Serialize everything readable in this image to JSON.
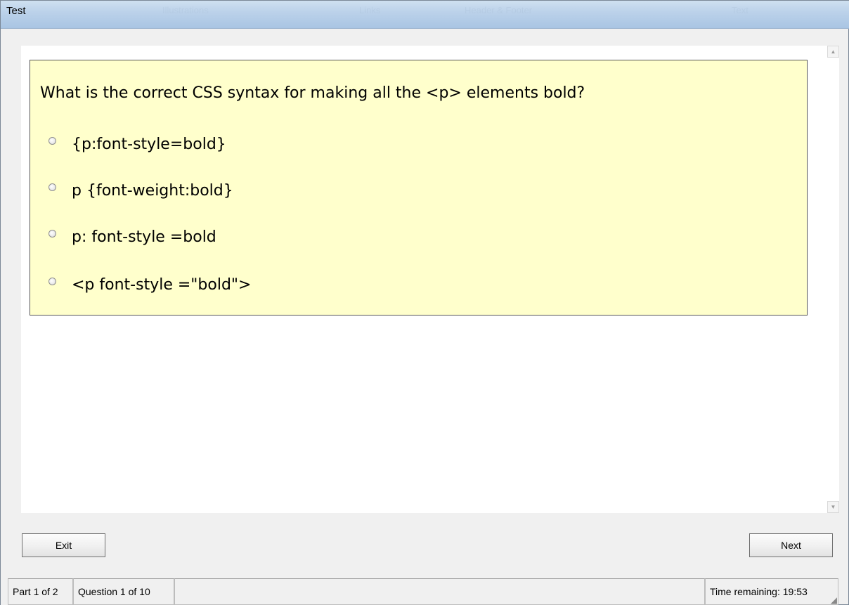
{
  "window": {
    "title": "Test",
    "ghost_ribbon": [
      "Illustrations",
      "Links",
      "Header & Footer",
      "Text"
    ]
  },
  "question": {
    "text": "What is the correct CSS syntax for making all the <p> elements bold?",
    "options": [
      {
        "label": "{p:font-style=bold}",
        "selected": false
      },
      {
        "label": "p {font-weight:bold}",
        "selected": false
      },
      {
        "label": "p: font-style =bold",
        "selected": false
      },
      {
        "label": "<p font-style =\"bold\">",
        "selected": false
      }
    ]
  },
  "scrollbar": {
    "up_icon": "▲",
    "down_icon": "▼"
  },
  "buttons": {
    "exit_label": "Exit",
    "next_label": "Next"
  },
  "status": {
    "part": "Part 1 of 2",
    "question": "Question 1 of 10",
    "time_remaining": "Time remaining: 19:53"
  },
  "colors": {
    "question_background": "#ffffcc",
    "titlebar": "#bcd2ea"
  }
}
